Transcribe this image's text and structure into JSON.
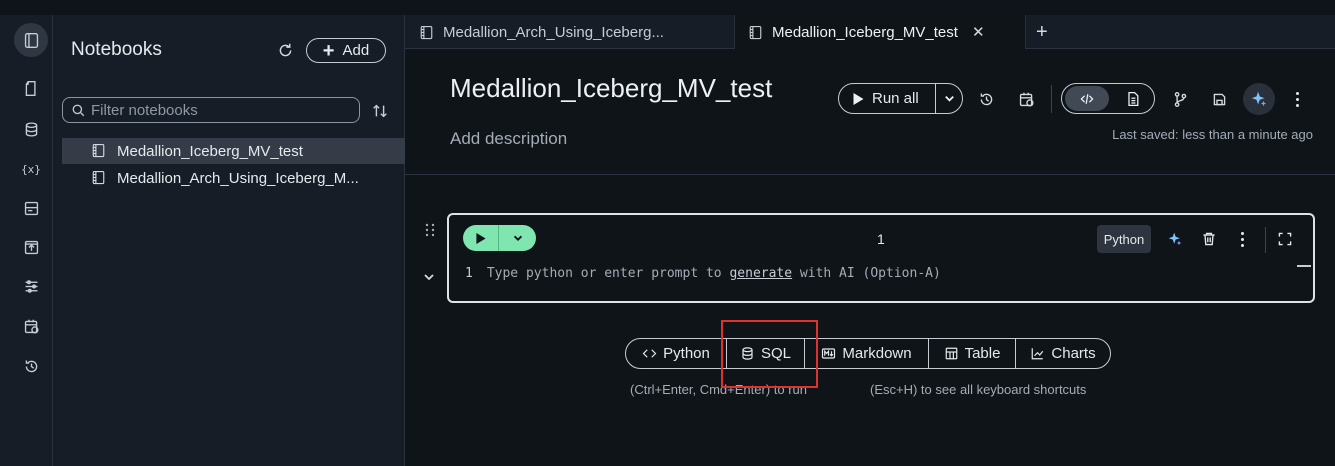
{
  "sidebar": {
    "title": "Notebooks",
    "add_label": "Add",
    "filter_placeholder": "Filter notebooks",
    "items": [
      {
        "label": "Medallion_Iceberg_MV_test"
      },
      {
        "label": "Medallion_Arch_Using_Iceberg_M..."
      }
    ],
    "rail_variables_label": "{x}"
  },
  "tabs": [
    {
      "label": "Medallion_Arch_Using_Iceberg..."
    },
    {
      "label": "Medallion_Iceberg_MV_test"
    }
  ],
  "notebook": {
    "title": "Medallion_Iceberg_MV_test",
    "description_placeholder": "Add description",
    "run_all_label": "Run all",
    "last_saved": "Last saved: less than a minute ago"
  },
  "cell": {
    "number": "1",
    "language": "Python",
    "line_number": "1",
    "placeholder_before": "Type python or enter prompt to ",
    "placeholder_link": "generate",
    "placeholder_after": " with AI (Option-A)"
  },
  "add_cell": {
    "options": [
      {
        "label": "Python",
        "icon": "code-icon"
      },
      {
        "label": "SQL",
        "icon": "database-icon"
      },
      {
        "label": "Markdown",
        "icon": "markdown-icon"
      },
      {
        "label": "Table",
        "icon": "table-icon"
      },
      {
        "label": "Charts",
        "icon": "chart-icon"
      }
    ],
    "hint_run": "(Ctrl+Enter, Cmd+Enter) to run",
    "hint_shortcuts": "(Esc+H) to see all keyboard shortcuts"
  },
  "colors": {
    "accent_run": "#7fe6b0",
    "highlight_box": "#e0312a",
    "background": "#0f1419"
  }
}
